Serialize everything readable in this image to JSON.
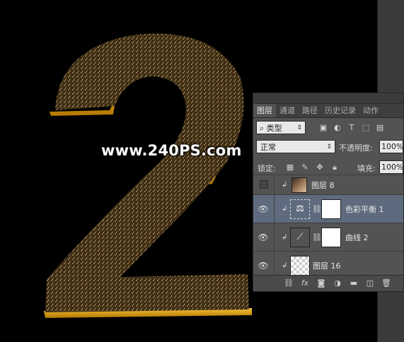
{
  "watermark": "www.240PS.com",
  "panel": {
    "tabs": [
      "图层",
      "通道",
      "路径",
      "历史记录",
      "动作"
    ],
    "active_tab": 0,
    "filter_kind": "类型",
    "filter_icons": [
      "image-filter-icon",
      "adjustment-filter-icon",
      "text-filter-icon",
      "shape-filter-icon",
      "smart-object-filter-icon"
    ],
    "blend_mode": "正常",
    "opacity_label": "不透明度:",
    "opacity_value": "100%",
    "lock_label": "锁定:",
    "fill_label": "填充:",
    "fill_value": "100%",
    "layers": [
      {
        "name": "图层 8",
        "visible": false,
        "clipped": true,
        "thumb": "gradient-photo"
      },
      {
        "name": "色彩平衡 1",
        "visible": true,
        "clipped": true,
        "thumb": "color-balance-adjustment",
        "mask": true,
        "selected": true
      },
      {
        "name": "曲线 2",
        "visible": true,
        "clipped": true,
        "thumb": "curves-adjustment",
        "mask": true
      },
      {
        "name": "图层 16",
        "visible": true,
        "clipped": true,
        "thumb": "transparent"
      }
    ],
    "bottom_icons": [
      "link-layers-icon",
      "fx-icon",
      "add-mask-icon",
      "new-adjustment-icon",
      "new-group-icon",
      "new-layer-icon",
      "trash-icon"
    ]
  }
}
